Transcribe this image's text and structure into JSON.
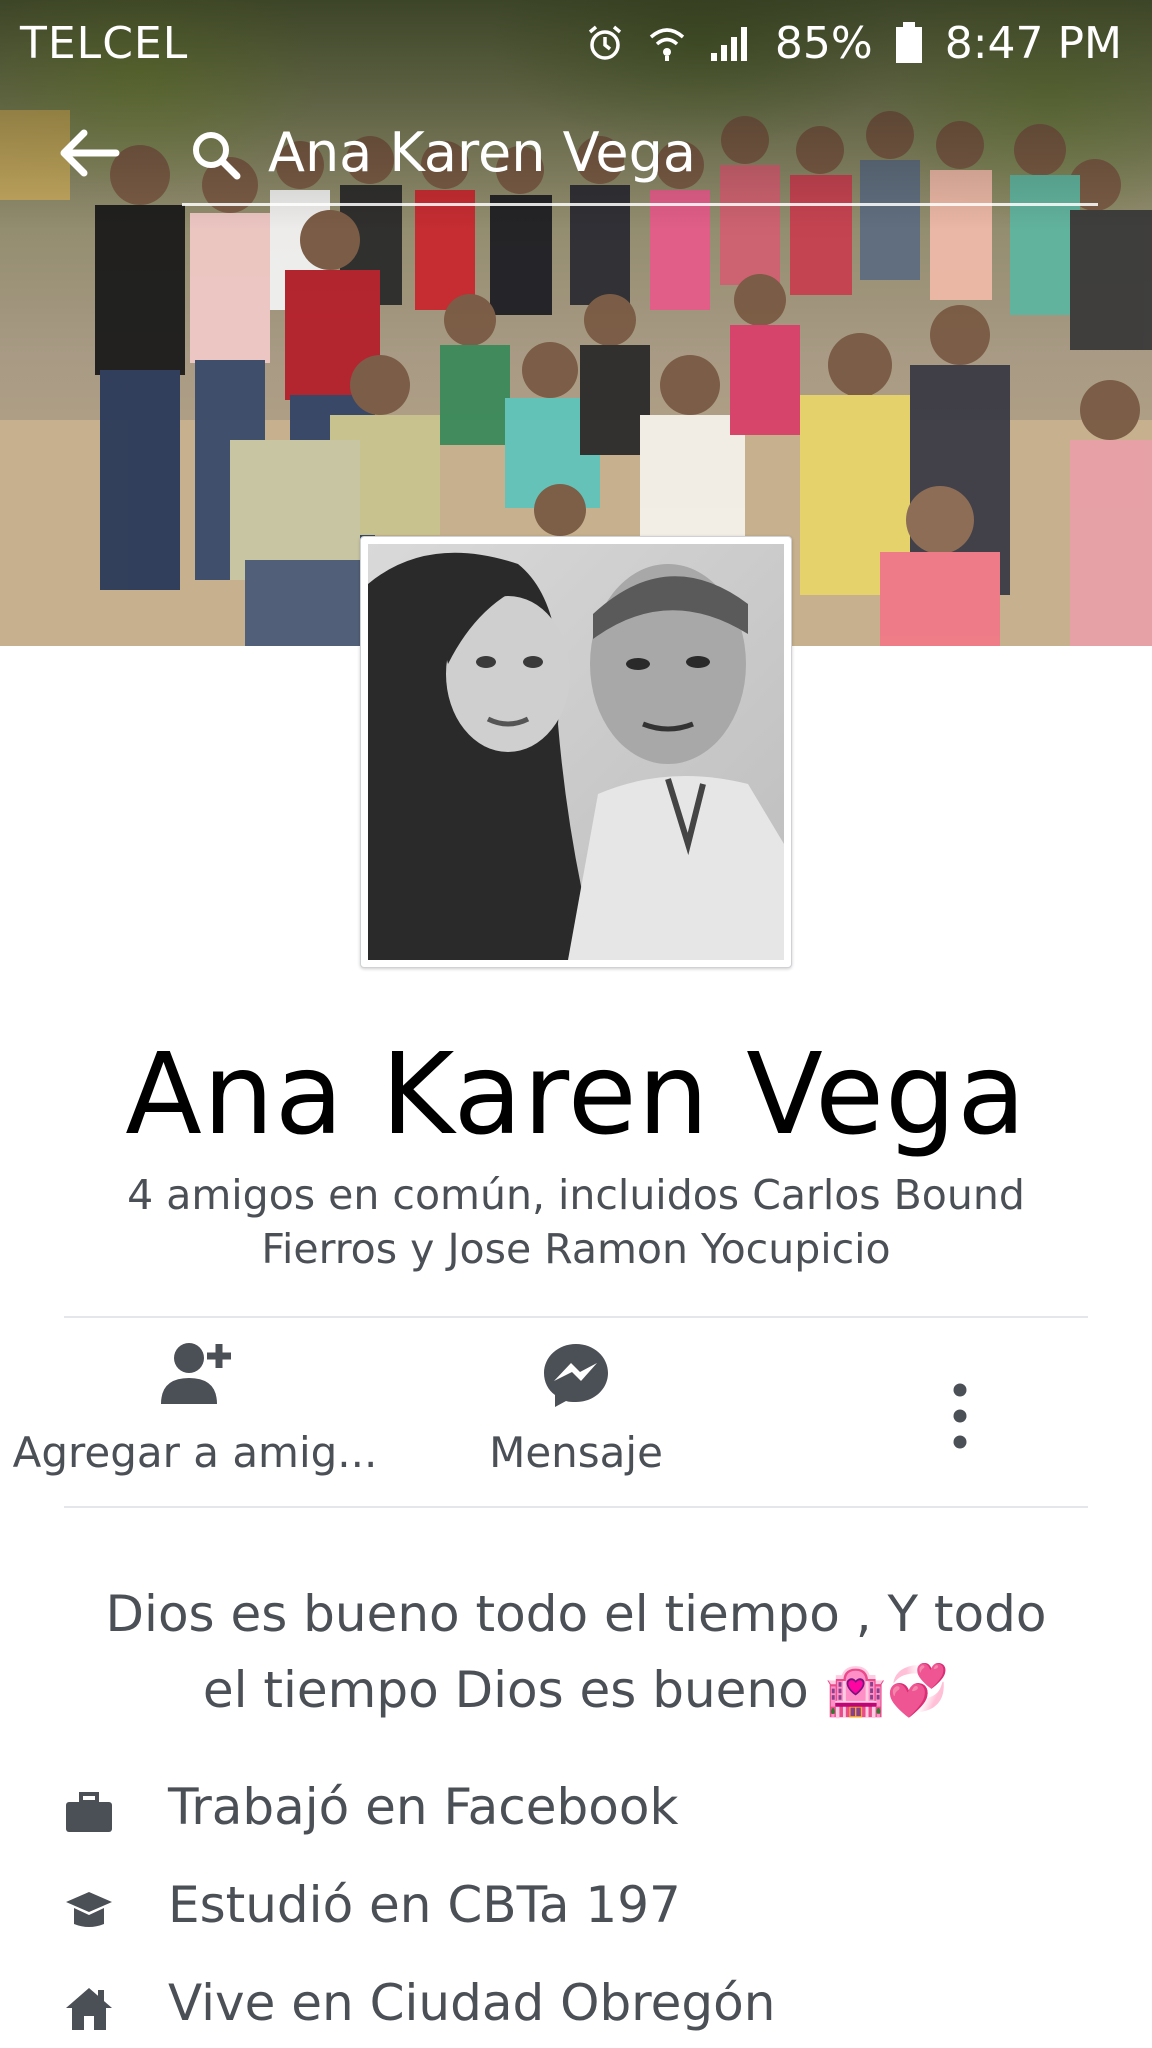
{
  "status_bar": {
    "carrier": "TELCEL",
    "battery": "85%",
    "time": "8:47 PM",
    "icons": [
      "alarm-icon",
      "wifi-icon",
      "signal-icon",
      "battery-icon"
    ]
  },
  "header": {
    "search_query": "Ana Karen Vega",
    "back_icon": "back-arrow-icon",
    "search_icon": "search-icon"
  },
  "profile": {
    "name": "Ana Karen Vega",
    "mutual_friends": "4 amigos en común, incluidos Carlos Bound Fierros y Jose Ramon Yocupicio"
  },
  "actions": {
    "add_friend": "Agregar a amig...",
    "message": "Mensaje",
    "more_icon": "more-vertical-icon"
  },
  "bio": {
    "text": "Dios es bueno todo el tiempo , Y todo el tiempo Dios es bueno 🏩💞"
  },
  "info": [
    {
      "icon": "briefcase-icon",
      "text": "Trabajó en Facebook"
    },
    {
      "icon": "graduation-cap-icon",
      "text": "Estudió en CBTa 197"
    },
    {
      "icon": "home-icon",
      "text": "Vive en Ciudad Obregón"
    }
  ],
  "colors": {
    "text_primary": "#000000",
    "text_secondary": "#4b4f56",
    "icon_gray": "#4b4f56",
    "divider": "#e5e6e9"
  }
}
